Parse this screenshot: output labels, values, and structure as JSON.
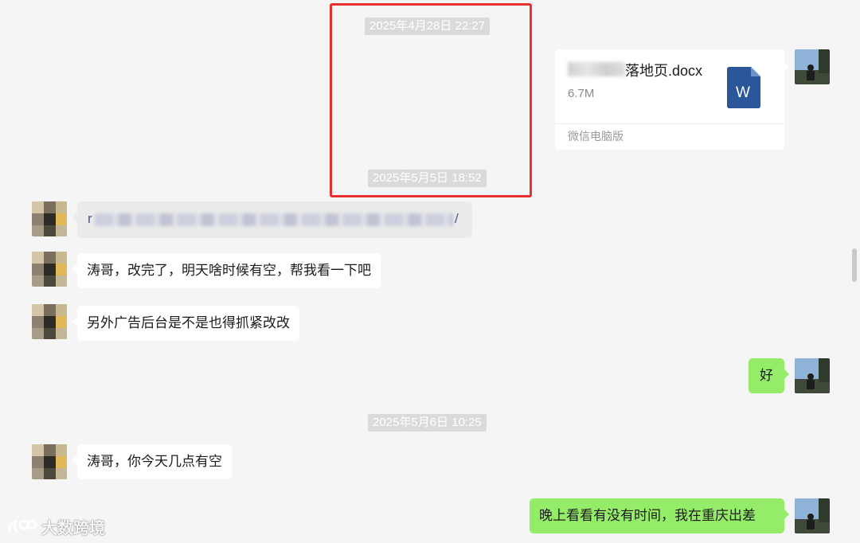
{
  "timestamps": [
    "2025年4月28日 22:27",
    "2025年5月5日 18:52",
    "2025年5月6日 10:25"
  ],
  "file_message": {
    "name_visible": "落地页.docx",
    "size": "6.7M",
    "source": "微信电脑版",
    "icon": "word-document-icon",
    "icon_letter": "W",
    "icon_color": "#2b579a"
  },
  "link_message": {
    "prefix": "r",
    "suffix": "/"
  },
  "messages": [
    {
      "side": "left",
      "text": "涛哥，改完了，明天啥时候有空，帮我看一下吧"
    },
    {
      "side": "left",
      "text": "另外广告后台是不是也得抓紧改改"
    },
    {
      "side": "right",
      "text": "好"
    },
    {
      "side": "left",
      "text": "涛哥，你今天几点有空"
    },
    {
      "side": "right",
      "text": "晚上看看有没有时间，我在重庆出差"
    }
  ],
  "watermark": {
    "text": "大数跨境"
  },
  "colors": {
    "background": "#f5f5f5",
    "self_bubble": "#95ec69",
    "other_bubble": "#ffffff",
    "highlight": "#e8302e",
    "timestamp_bg": "#dadada"
  }
}
